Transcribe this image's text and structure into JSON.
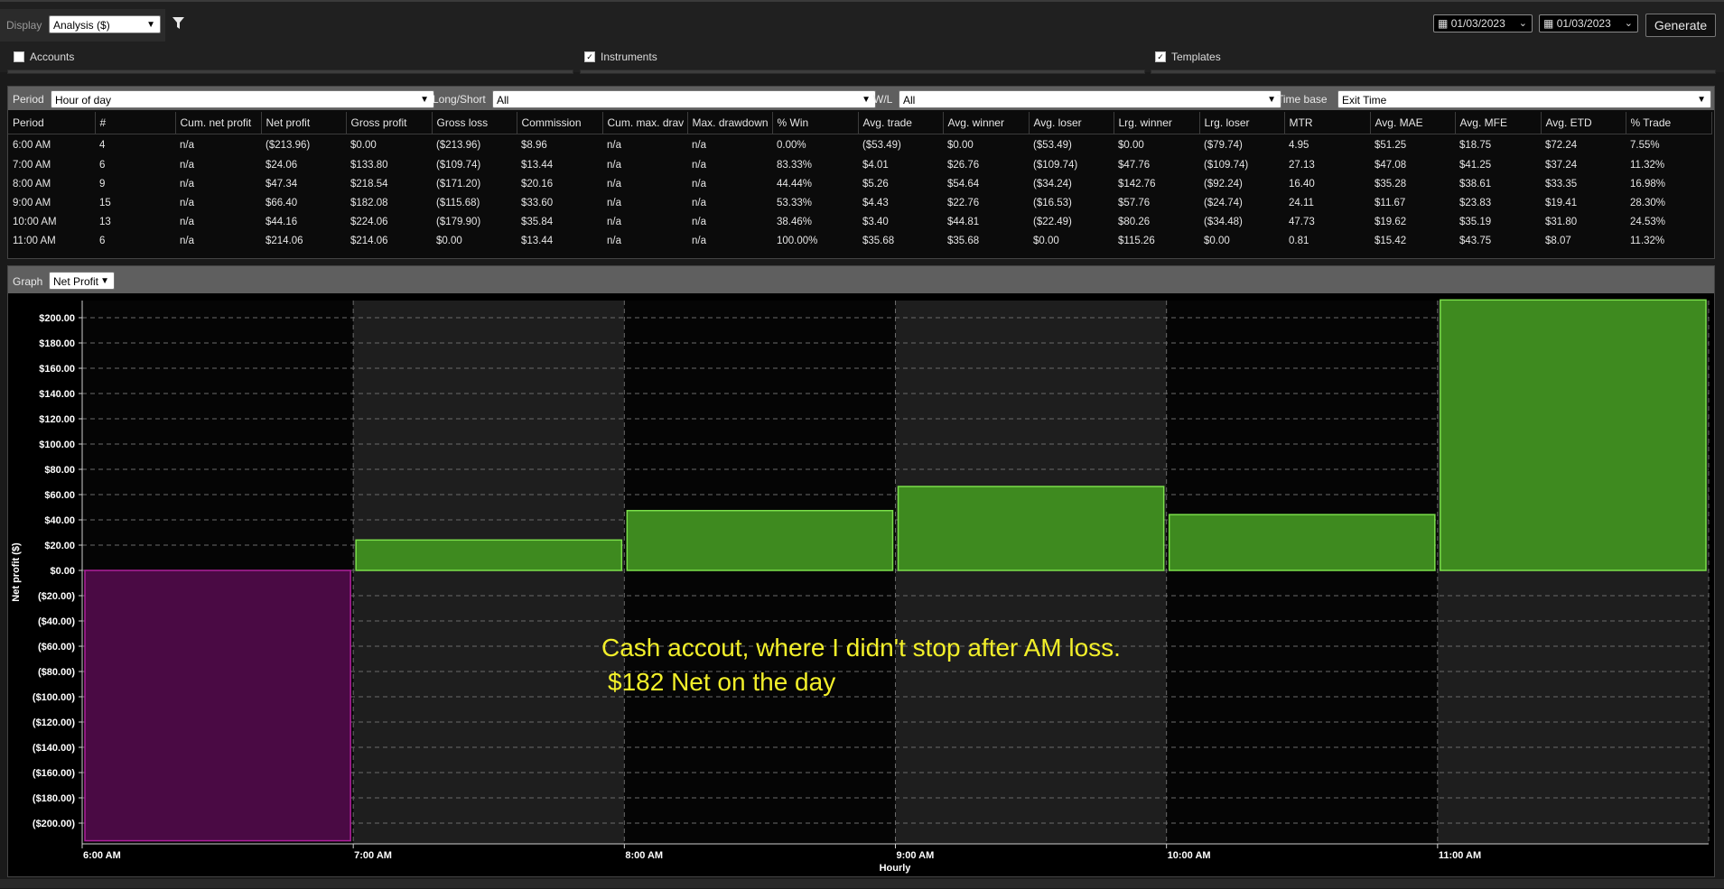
{
  "toolbar": {
    "display_label": "Display",
    "display_value": "Analysis ($)",
    "filter_icon": "funnel-icon",
    "date_from": "01/03/2023",
    "date_to": "01/03/2023",
    "generate_label": "Generate",
    "accounts_label": "Accounts",
    "accounts_checked": false,
    "instruments_label": "Instruments",
    "instruments_checked": true,
    "templates_label": "Templates",
    "templates_checked": true
  },
  "filters": {
    "period_label": "Period",
    "period_value": "Hour of day",
    "longshort_label": "Long/Short",
    "longshort_value": "All",
    "wl_label": "W/L",
    "wl_value": "All",
    "timebase_label": "Time base",
    "timebase_value": "Exit Time"
  },
  "table": {
    "columns": [
      "Period",
      "#",
      "Cum. net profit",
      "Net profit",
      "Gross profit",
      "Gross loss",
      "Commission",
      "Cum. max. drav",
      "Max. drawdown",
      "% Win",
      "Avg. trade",
      "Avg. winner",
      "Avg. loser",
      "Lrg. winner",
      "Lrg. loser",
      "MTR",
      "Avg. MAE",
      "Avg. MFE",
      "Avg. ETD",
      "% Trade"
    ],
    "rows": [
      [
        "6:00 AM",
        "4",
        "n/a",
        "($213.96)",
        "$0.00",
        "($213.96)",
        "$8.96",
        "n/a",
        "n/a",
        "0.00%",
        "($53.49)",
        "$0.00",
        "($53.49)",
        "$0.00",
        "($79.74)",
        "4.95",
        "$51.25",
        "$18.75",
        "$72.24",
        "7.55%"
      ],
      [
        "7:00 AM",
        "6",
        "n/a",
        "$24.06",
        "$133.80",
        "($109.74)",
        "$13.44",
        "n/a",
        "n/a",
        "83.33%",
        "$4.01",
        "$26.76",
        "($109.74)",
        "$47.76",
        "($109.74)",
        "27.13",
        "$47.08",
        "$41.25",
        "$37.24",
        "11.32%"
      ],
      [
        "8:00 AM",
        "9",
        "n/a",
        "$47.34",
        "$218.54",
        "($171.20)",
        "$20.16",
        "n/a",
        "n/a",
        "44.44%",
        "$5.26",
        "$54.64",
        "($34.24)",
        "$142.76",
        "($92.24)",
        "16.40",
        "$35.28",
        "$38.61",
        "$33.35",
        "16.98%"
      ],
      [
        "9:00 AM",
        "15",
        "n/a",
        "$66.40",
        "$182.08",
        "($115.68)",
        "$33.60",
        "n/a",
        "n/a",
        "53.33%",
        "$4.43",
        "$22.76",
        "($16.53)",
        "$57.76",
        "($24.74)",
        "24.11",
        "$11.67",
        "$23.83",
        "$19.41",
        "28.30%"
      ],
      [
        "10:00 AM",
        "13",
        "n/a",
        "$44.16",
        "$224.06",
        "($179.90)",
        "$35.84",
        "n/a",
        "n/a",
        "38.46%",
        "$3.40",
        "$44.81",
        "($22.49)",
        "$80.26",
        "($34.48)",
        "47.73",
        "$19.62",
        "$35.19",
        "$31.80",
        "24.53%"
      ],
      [
        "11:00 AM",
        "6",
        "n/a",
        "$214.06",
        "$214.06",
        "$0.00",
        "$13.44",
        "n/a",
        "n/a",
        "100.00%",
        "$35.68",
        "$35.68",
        "$0.00",
        "$115.26",
        "$0.00",
        "0.81",
        "$15.42",
        "$43.75",
        "$8.07",
        "11.32%"
      ]
    ]
  },
  "graph": {
    "label": "Graph",
    "select_value": "Net Profit",
    "annotation_line1": "Cash accout, where I didn't stop after AM loss.",
    "annotation_line2": "$182 Net on the day"
  },
  "chart_data": {
    "type": "bar",
    "categories": [
      "6:00 AM",
      "7:00 AM",
      "8:00 AM",
      "9:00 AM",
      "10:00 AM",
      "11:00 AM"
    ],
    "values": [
      -213.96,
      24.06,
      47.34,
      66.4,
      44.16,
      214.06
    ],
    "xlabel": "Hourly",
    "ylabel": "Net profit ($)",
    "ylim": [
      -210,
      210
    ],
    "yticks": [
      200,
      180,
      160,
      140,
      120,
      100,
      80,
      60,
      40,
      20,
      0,
      -20,
      -40,
      -60,
      -80,
      -100,
      -120,
      -140,
      -160,
      -180,
      -200
    ],
    "ytick_labels": [
      "$200.00",
      "$180.00",
      "$160.00",
      "$140.00",
      "$120.00",
      "$100.00",
      "$80.00",
      "$60.00",
      "$40.00",
      "$20.00",
      "$0.00",
      "($20.00)",
      "($40.00)",
      "($60.00)",
      "($80.00)",
      "($100.00)",
      "($120.00)",
      "($140.00)",
      "($160.00)",
      "($180.00)",
      "($200.00)"
    ],
    "positive_color": "#3e8a1f",
    "negative_color": "#4a0a44",
    "grid": true
  }
}
